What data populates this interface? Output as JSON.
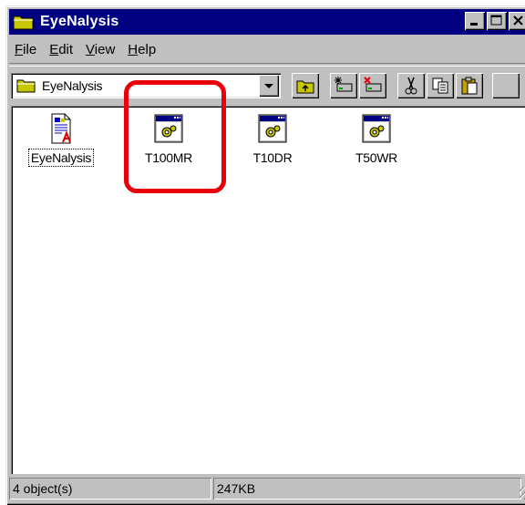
{
  "window": {
    "title": "EyeNalysis",
    "controls": [
      "minimize-button",
      "maximize-button",
      "close-button"
    ]
  },
  "menu": {
    "items": [
      {
        "label": "File",
        "underline": "F",
        "rest": "ile"
      },
      {
        "label": "Edit",
        "underline": "E",
        "rest": "dit"
      },
      {
        "label": "View",
        "underline": "V",
        "rest": "iew"
      },
      {
        "label": "Help",
        "underline": "H",
        "rest": "elp"
      }
    ]
  },
  "toolbar": {
    "address_value": "EyeNalysis",
    "buttons": [
      "up-folder-icon",
      "map-drive-icon",
      "disconnect-drive-icon",
      "cut-icon",
      "copy-icon",
      "paste-icon"
    ]
  },
  "files": [
    {
      "name": "EyeNalysis",
      "icon": "document-icon",
      "focused": true
    },
    {
      "name": "T100MR",
      "icon": "application-icon",
      "focused": false
    },
    {
      "name": "T10DR",
      "icon": "application-icon",
      "focused": false
    },
    {
      "name": "T50WR",
      "icon": "application-icon",
      "focused": false
    }
  ],
  "status": {
    "objects": "4 object(s)",
    "size": "247KB"
  },
  "colors": {
    "titlebar": "#000080",
    "face": "#c0c0c0",
    "highlight_annotation": "#e8000b"
  }
}
